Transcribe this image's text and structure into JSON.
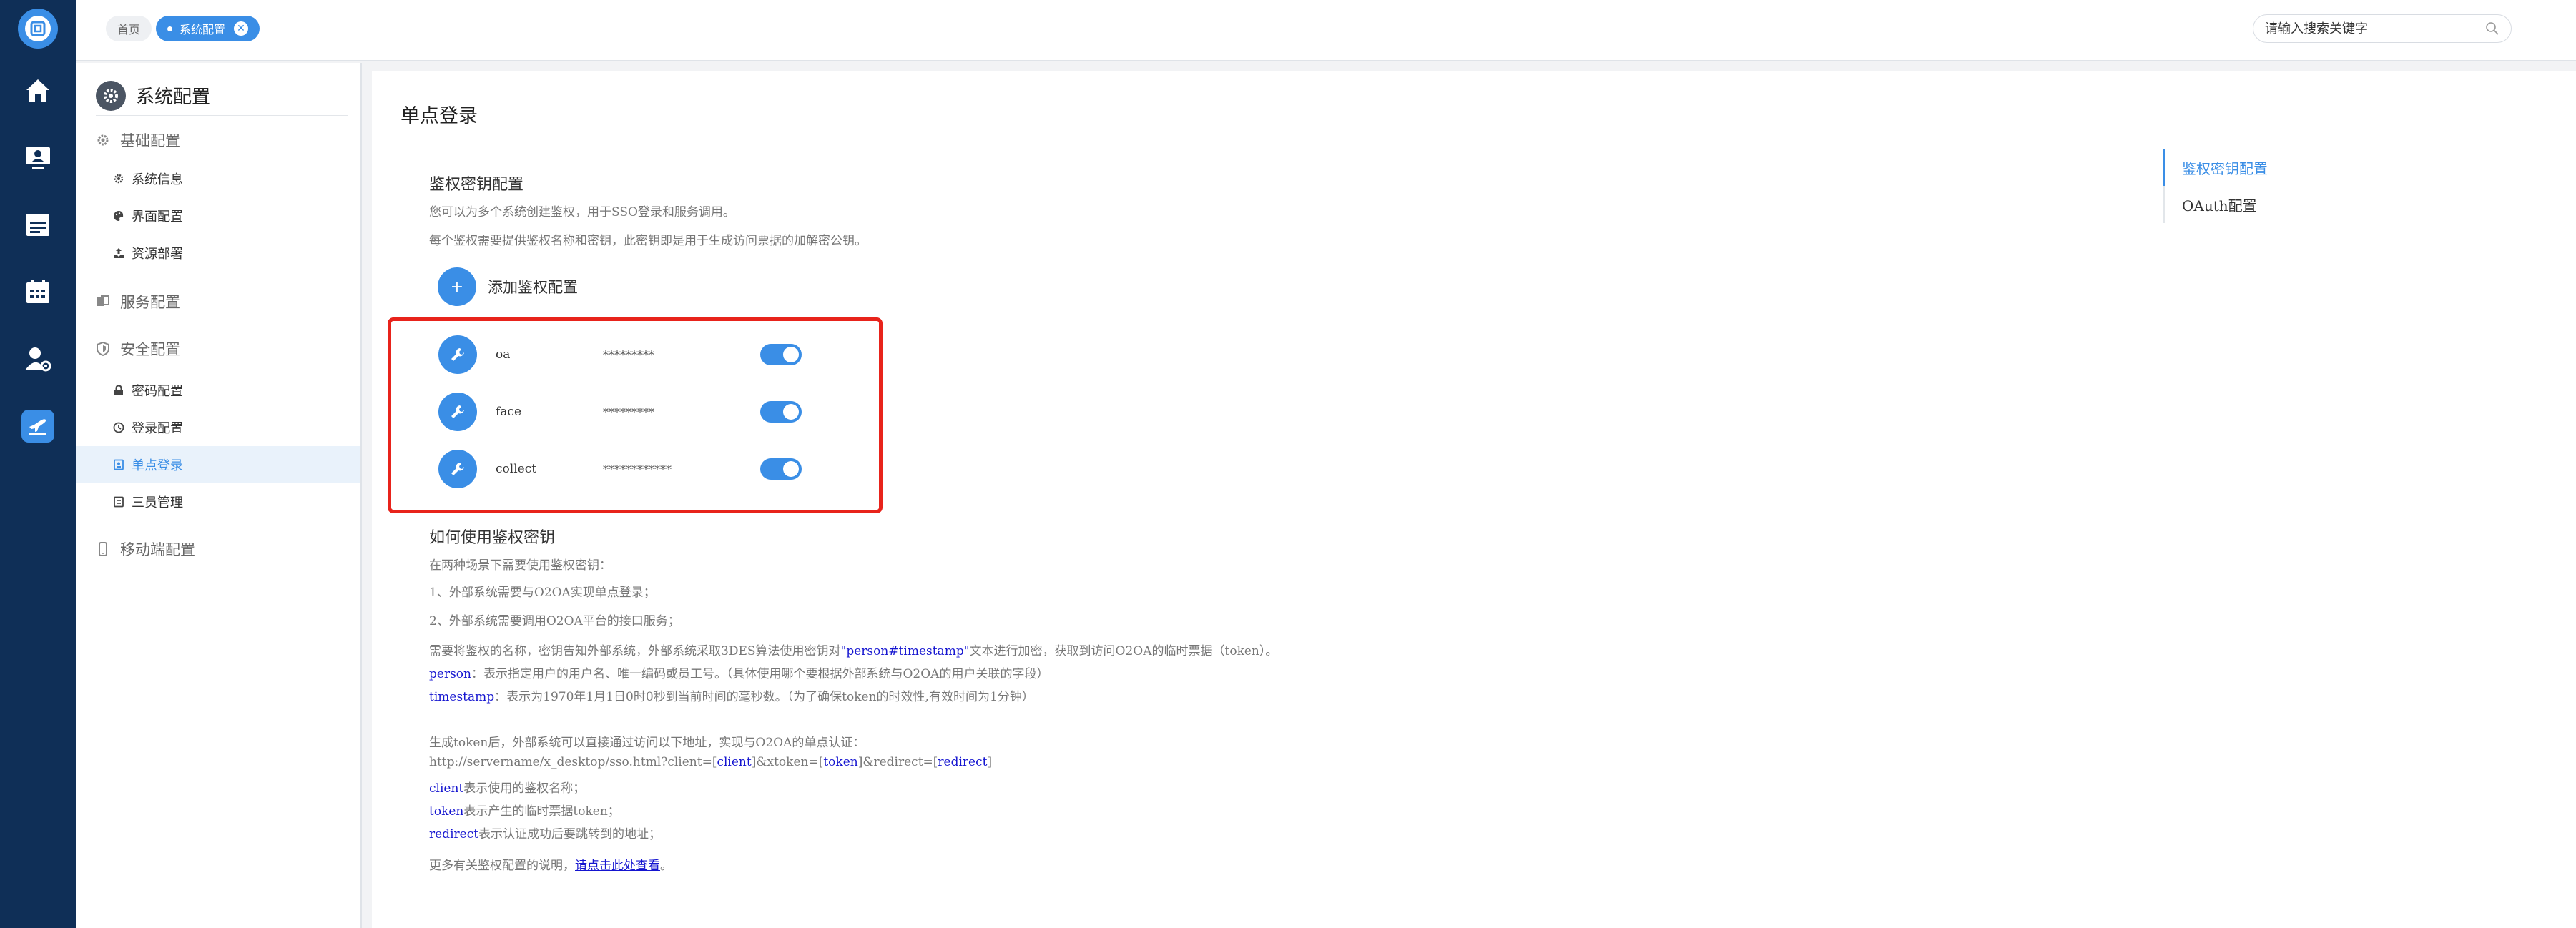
{
  "topbar": {
    "tabs": [
      {
        "label": "首页"
      },
      {
        "label": "系统配置"
      }
    ],
    "search_placeholder": "请输入搜索关键字"
  },
  "rail": {
    "icons": [
      "app-logo-icon",
      "home-icon",
      "monitor-user-icon",
      "calendar-list-icon",
      "calendar-icon",
      "user-settings-icon",
      "plane-icon"
    ]
  },
  "sidebar": {
    "title": "系统配置",
    "groups": [
      {
        "label": "基础配置",
        "items": [
          "系统信息",
          "界面配置",
          "资源部署"
        ]
      },
      {
        "label": "服务配置",
        "items": []
      },
      {
        "label": "安全配置",
        "items": [
          "密码配置",
          "登录配置",
          "单点登录",
          "三员管理"
        ]
      },
      {
        "label": "移动端配置",
        "items": []
      }
    ],
    "active_item": "单点登录"
  },
  "main": {
    "title": "单点登录",
    "section1": {
      "heading": "鉴权密钥配置",
      "desc1": "您可以为多个系统创建鉴权，用于SSO登录和服务调用。",
      "desc2": "每个鉴权需要提供鉴权名称和密钥，此密钥即是用于生成访问票据的加解密公钥。",
      "add_label": "添加鉴权配置",
      "keys": [
        {
          "name": "oa",
          "secret": "*********",
          "enabled": true
        },
        {
          "name": "face",
          "secret": "*********",
          "enabled": true
        },
        {
          "name": "collect",
          "secret": "************",
          "enabled": true
        }
      ]
    },
    "section2": {
      "heading": "如何使用鉴权密钥",
      "l1": "在两种场景下需要使用鉴权密钥：",
      "l2": "1、外部系统需要与O2OA实现单点登录；",
      "l3": "2、外部系统需要调用O2OA平台的接口服务；",
      "l4a": "需要将鉴权的名称，密钥告知外部系统，外部系统采取3DES算法使用密钥对",
      "l4b": "\"person#timestamp\"",
      "l4c": "文本进行加密，获取到访问O2OA的临时票据（token）。",
      "l5a": "person",
      "l5b": "：表示指定用户的用户名、唯一编码或员工号。（具体使用哪个要根据外部系统与O2OA的用户关联的字段）",
      "l6a": "timestamp",
      "l6b": "：表示为1970年1月1日0时0秒到当前时间的毫秒数。（为了确保token的时效性,有效时间为1分钟）",
      "l7": "生成token后，外部系统可以直接通过访问以下地址，实现与O2OA的单点认证：",
      "url_a": "http://servername/x_desktop/sso.html?client=[",
      "url_client": "client",
      "url_b": "]&xtoken=[",
      "url_token": "token",
      "url_c": "]&redirect=[",
      "url_redirect": "redirect",
      "url_d": "]",
      "l9a": "client",
      "l9b": "表示使用的鉴权名称；",
      "l10a": "token",
      "l10b": "表示产生的临时票据token；",
      "l11a": "redirect",
      "l11b": "表示认证成功后要跳转到的地址；",
      "l12a": "更多有关鉴权配置的说明，",
      "l12link": "请点击此处查看",
      "l12b": "。"
    },
    "right_nav": [
      "鉴权密钥配置",
      "OAuth配置"
    ]
  },
  "colors": {
    "accent": "#3a8ee6",
    "rail": "#0f2f57",
    "highlight_border": "#e8231b",
    "link_blue": "#1515d0"
  }
}
